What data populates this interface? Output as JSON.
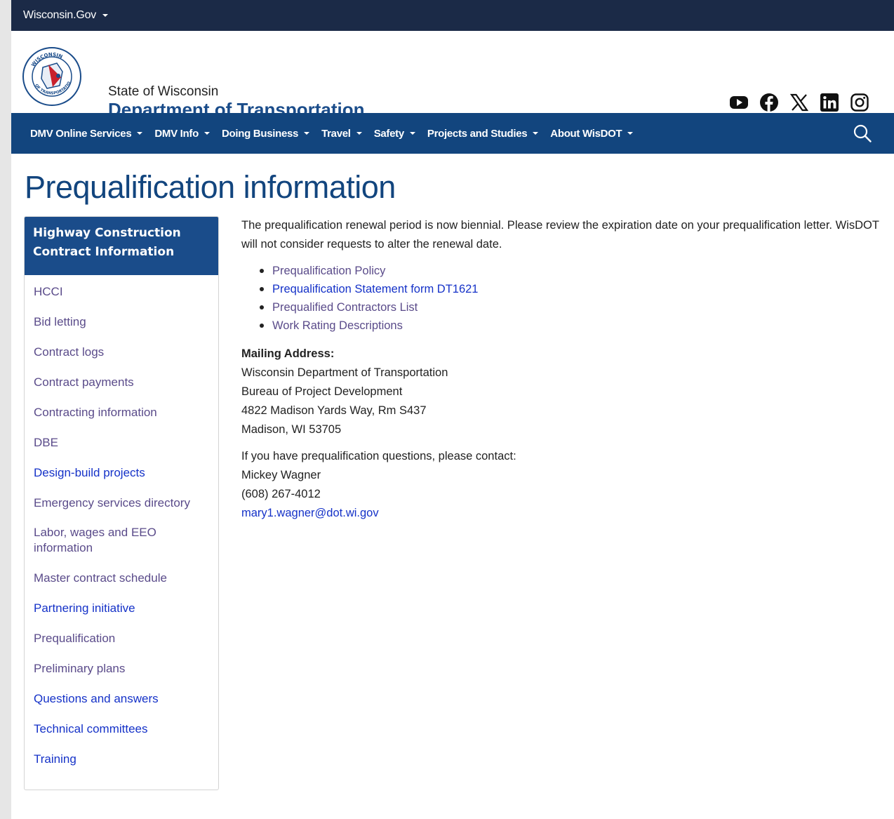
{
  "topbar": {
    "gov_label": "Wisconsin.Gov"
  },
  "header": {
    "state": "State of Wisconsin",
    "department": "Department of Transportation",
    "seal_text_top": "WISCONSIN",
    "seal_text_left": "DEPARTMENT",
    "seal_text_bottom": "OF TRANSPORTATION",
    "social": [
      "youtube-icon",
      "facebook-icon",
      "x-icon",
      "linkedin-icon",
      "instagram-icon"
    ]
  },
  "nav": {
    "items": [
      {
        "label": "DMV Online Services"
      },
      {
        "label": "DMV Info"
      },
      {
        "label": "Doing Business"
      },
      {
        "label": "Travel"
      },
      {
        "label": "Safety"
      },
      {
        "label": "Projects and Studies"
      },
      {
        "label": "About WisDOT"
      }
    ],
    "search_icon": "search-icon"
  },
  "page": {
    "title": "Prequalification information"
  },
  "sidebar": {
    "heading": "Highway Construction Contract Information",
    "items": [
      {
        "label": "HCCI",
        "visited": true
      },
      {
        "label": "Bid letting",
        "visited": true
      },
      {
        "label": "Contract logs",
        "visited": true
      },
      {
        "label": "Contract payments",
        "visited": true
      },
      {
        "label": "Contracting information",
        "visited": true
      },
      {
        "label": "DBE",
        "visited": true
      },
      {
        "label": "Design-build projects",
        "visited": false
      },
      {
        "label": "Emergency services directory",
        "visited": true
      },
      {
        "label": "Labor, wages and EEO information",
        "visited": true
      },
      {
        "label": "Master contract schedule",
        "visited": true
      },
      {
        "label": "Partnering initiative",
        "visited": false
      },
      {
        "label": "Prequalification",
        "visited": true
      },
      {
        "label": "Preliminary plans",
        "visited": true
      },
      {
        "label": "Questions and answers",
        "visited": false
      },
      {
        "label": "Technical committees",
        "visited": false
      },
      {
        "label": "Training",
        "visited": false
      }
    ]
  },
  "content": {
    "intro": "The prequalification renewal period is now biennial. Please review the expiration date on your prequalification letter. WisDOT will not consider requests to alter the renewal date.",
    "links": [
      {
        "label": "Prequalification Policy",
        "visited": true
      },
      {
        "label": "Prequalification Statement form DT1621",
        "visited": false
      },
      {
        "label": "Prequalified Contractors List",
        "visited": true
      },
      {
        "label": "Work Rating Descriptions",
        "visited": true
      }
    ],
    "mailing_heading": "Mailing Address:",
    "address": [
      "Wisconsin Department of Transportation",
      "Bureau of Project Development",
      "4822 Madison Yards Way, Rm S437",
      "Madison, WI  53705"
    ],
    "contact_intro": "If you have prequalification questions, please contact:",
    "contact_name": "Mickey Wagner",
    "contact_phone": "(608) 267-4012",
    "contact_email": "mary1.wagner@dot.wi.gov"
  },
  "colors": {
    "topbar": "#1b2a47",
    "nav": "#12457e",
    "sidebar_head": "#1a4c8a",
    "link_visited": "#5a4b8a",
    "link": "#1532c8"
  }
}
